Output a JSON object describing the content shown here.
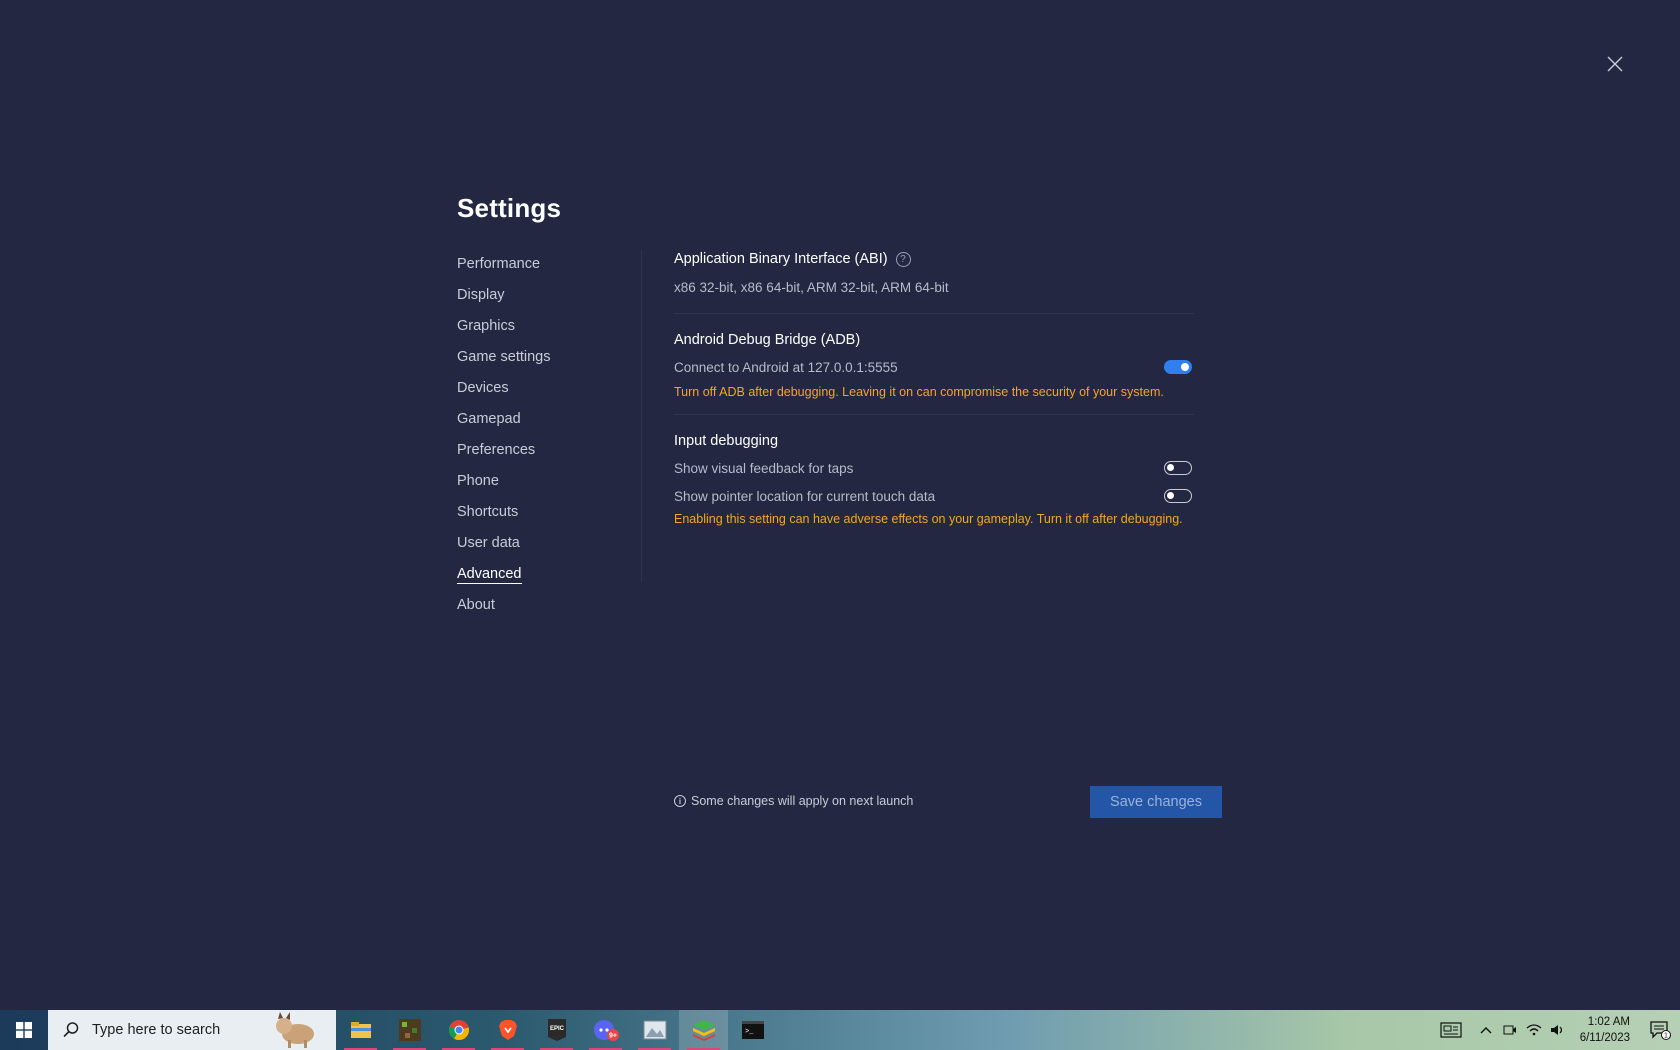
{
  "window": {
    "title": "Settings",
    "close_icon": "close-icon"
  },
  "sidebar": {
    "items": [
      {
        "label": "Performance"
      },
      {
        "label": "Display"
      },
      {
        "label": "Graphics"
      },
      {
        "label": "Game settings"
      },
      {
        "label": "Devices"
      },
      {
        "label": "Gamepad"
      },
      {
        "label": "Preferences"
      },
      {
        "label": "Phone"
      },
      {
        "label": "Shortcuts"
      },
      {
        "label": "User data"
      },
      {
        "label": "Advanced"
      },
      {
        "label": "About"
      }
    ],
    "active": "Advanced"
  },
  "content": {
    "abi": {
      "title": "Application Binary Interface (ABI)",
      "help_icon": "question-circle-icon",
      "value": "x86 32-bit, x86 64-bit, ARM 32-bit, ARM 64-bit"
    },
    "adb": {
      "title": "Android Debug Bridge (ADB)",
      "connect_label": "Connect to Android at 127.0.0.1:5555",
      "toggle_on": true,
      "warning": "Turn off ADB after debugging. Leaving it on can compromise the security of your system."
    },
    "input_debugging": {
      "title": "Input debugging",
      "taps_label": "Show visual feedback for taps",
      "taps_on": false,
      "pointer_label": "Show pointer location for current touch data",
      "pointer_on": false,
      "warning": "Enabling this setting can have adverse effects on your gameplay. Turn it off after debugging."
    }
  },
  "footer": {
    "note": "Some changes will apply on next launch",
    "info_icon": "info-icon",
    "save_label": "Save changes"
  },
  "taskbar": {
    "search_placeholder": "Type here to search",
    "apps": [
      "file-explorer-icon",
      "minecraft-icon",
      "chrome-icon",
      "brave-icon",
      "epic-games-icon",
      "discord-icon",
      "photos-icon",
      "bluestacks-icon",
      "terminal-icon"
    ],
    "discord_badge": "9+",
    "time": "1:02 AM",
    "date": "6/11/2023",
    "notification_count": "1"
  },
  "colors": {
    "background": "#232742",
    "accent": "#2f7ff0",
    "warning": "#f5a623",
    "save_button": "#2356a6"
  }
}
